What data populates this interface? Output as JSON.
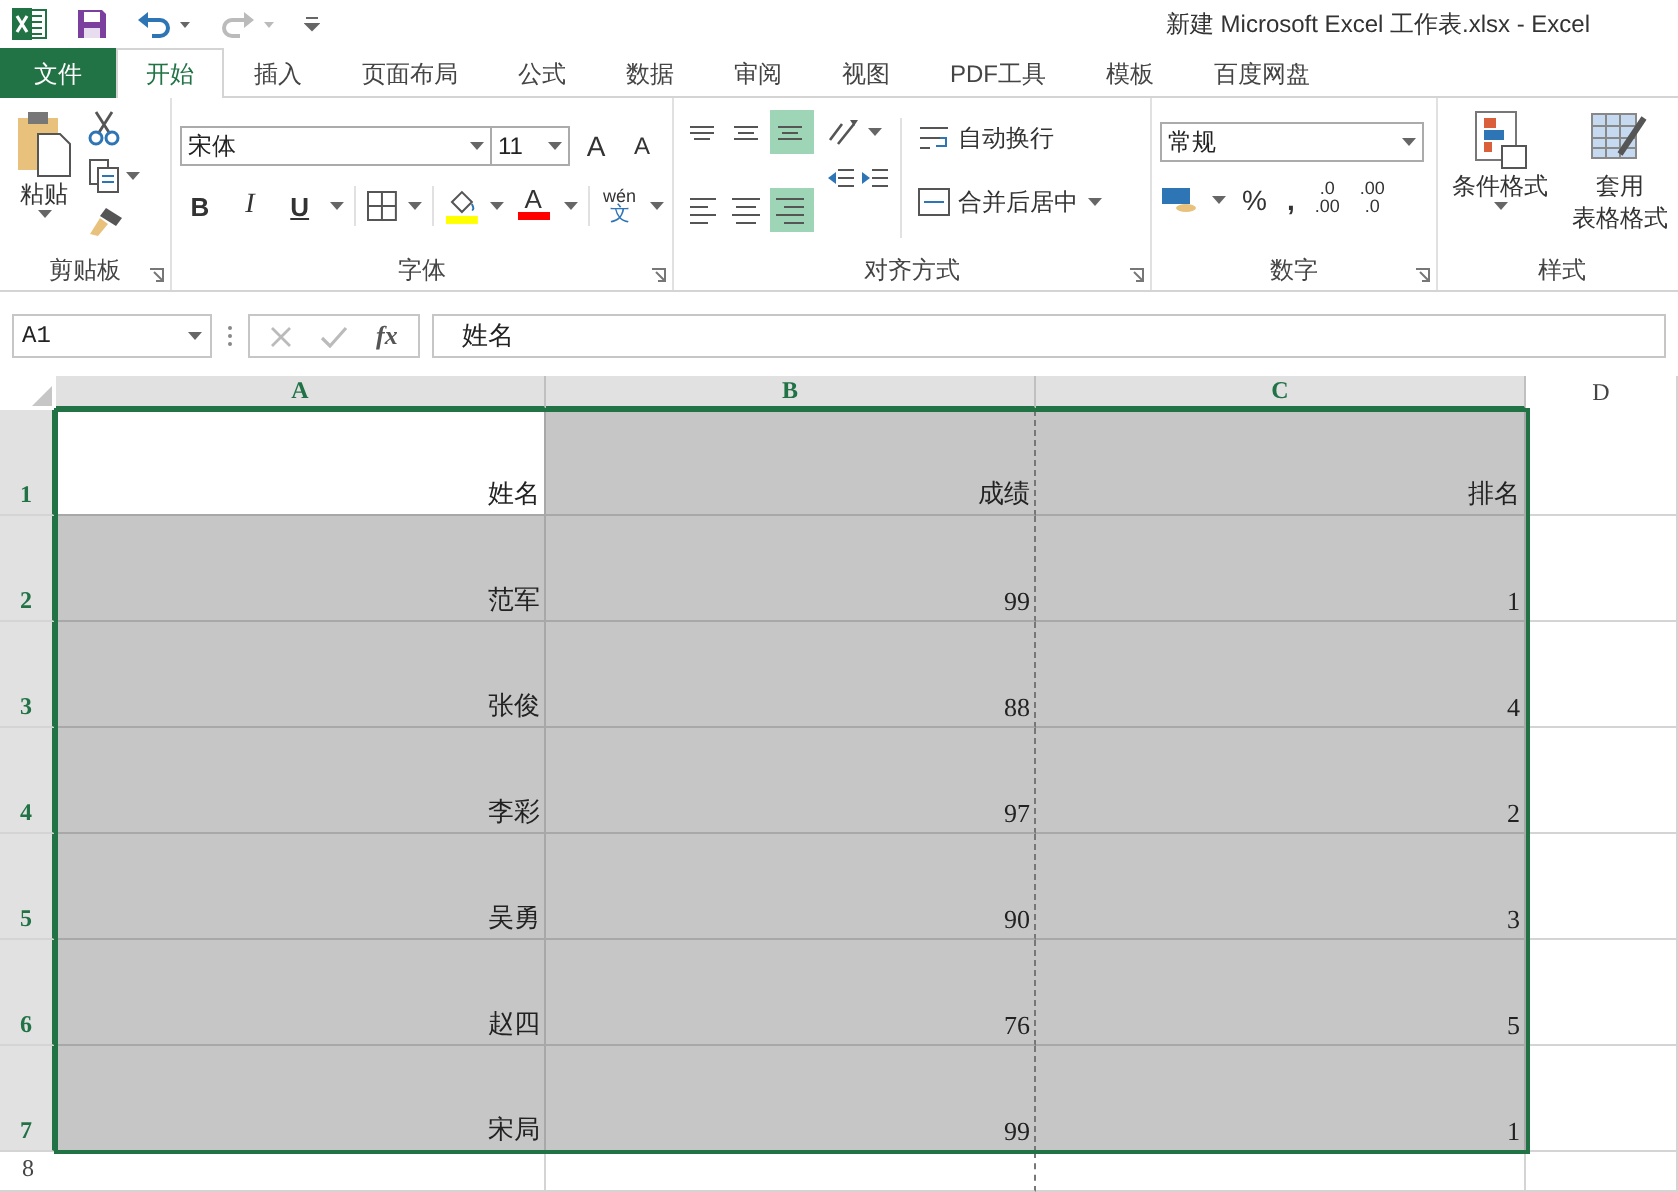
{
  "window": {
    "title": "新建 Microsoft Excel 工作表.xlsx - Excel"
  },
  "tabs": [
    {
      "label": "文件",
      "kind": "file",
      "selected": false
    },
    {
      "label": "开始",
      "kind": "tab",
      "selected": true
    },
    {
      "label": "插入",
      "kind": "tab",
      "selected": false
    },
    {
      "label": "页面布局",
      "kind": "tab",
      "selected": false
    },
    {
      "label": "公式",
      "kind": "tab",
      "selected": false
    },
    {
      "label": "数据",
      "kind": "tab",
      "selected": false
    },
    {
      "label": "审阅",
      "kind": "tab",
      "selected": false
    },
    {
      "label": "视图",
      "kind": "tab",
      "selected": false
    },
    {
      "label": "PDF工具",
      "kind": "tab",
      "selected": false
    },
    {
      "label": "模板",
      "kind": "tab",
      "selected": false
    },
    {
      "label": "百度网盘",
      "kind": "tab",
      "selected": false
    }
  ],
  "ribbon": {
    "clipboard": {
      "paste": "粘贴",
      "label": "剪贴板"
    },
    "font": {
      "name": "宋体",
      "size": "11",
      "grow": "A",
      "shrink": "A",
      "bold": "B",
      "italic": "I",
      "underline": "U",
      "font_color": "A",
      "phonetic_top": "wén",
      "phonetic_bottom": "文",
      "label": "字体"
    },
    "alignment": {
      "buttons": [
        {
          "kind": "top",
          "selected": false
        },
        {
          "kind": "middle",
          "selected": false
        },
        {
          "kind": "bottom",
          "selected": true
        },
        {
          "kind": "left",
          "selected": false
        },
        {
          "kind": "center",
          "selected": false
        },
        {
          "kind": "right",
          "selected": true
        }
      ],
      "wrap": "自动换行",
      "merge": "合并后居中",
      "label": "对齐方式"
    },
    "number": {
      "format": "常规",
      "percent": "%",
      "comma": ",",
      "increase_decimal": [
        ".0",
        ".00"
      ],
      "decrease_decimal": [
        ".00",
        ".0"
      ],
      "label": "数字"
    },
    "styles": {
      "conditional": "条件格式",
      "table_format_top": "套用",
      "table_format_bottom": "表格格式",
      "label": "样式"
    }
  },
  "formula_bar": {
    "name_box": "A1",
    "function_label": "fx",
    "formula": "姓名"
  },
  "sheet": {
    "columns": [
      {
        "label": "A",
        "selected": true
      },
      {
        "label": "B",
        "selected": true
      },
      {
        "label": "C",
        "selected": true
      },
      {
        "label": "D",
        "selected": false
      }
    ],
    "rows": [
      {
        "number": "1",
        "selected": true,
        "cells": [
          {
            "text": "姓名",
            "selected": true,
            "active": true
          },
          {
            "text": "成绩",
            "selected": true,
            "active": false
          },
          {
            "text": "排名",
            "selected": true,
            "active": false
          }
        ]
      },
      {
        "number": "2",
        "selected": true,
        "cells": [
          {
            "text": "范军",
            "selected": true,
            "active": false
          },
          {
            "text": "99",
            "selected": true,
            "active": false
          },
          {
            "text": "1",
            "selected": true,
            "active": false
          }
        ]
      },
      {
        "number": "3",
        "selected": true,
        "cells": [
          {
            "text": "张俊",
            "selected": true,
            "active": false
          },
          {
            "text": "88",
            "selected": true,
            "active": false
          },
          {
            "text": "4",
            "selected": true,
            "active": false
          }
        ]
      },
      {
        "number": "4",
        "selected": true,
        "cells": [
          {
            "text": "李彩",
            "selected": true,
            "active": false
          },
          {
            "text": "97",
            "selected": true,
            "active": false
          },
          {
            "text": "2",
            "selected": true,
            "active": false
          }
        ]
      },
      {
        "number": "5",
        "selected": true,
        "cells": [
          {
            "text": "吴勇",
            "selected": true,
            "active": false
          },
          {
            "text": "90",
            "selected": true,
            "active": false
          },
          {
            "text": "3",
            "selected": true,
            "active": false
          }
        ]
      },
      {
        "number": "6",
        "selected": true,
        "cells": [
          {
            "text": "赵四",
            "selected": true,
            "active": false
          },
          {
            "text": "76",
            "selected": true,
            "active": false
          },
          {
            "text": "5",
            "selected": true,
            "active": false
          }
        ]
      },
      {
        "number": "7",
        "selected": true,
        "cells": [
          {
            "text": "宋局",
            "selected": true,
            "active": false
          },
          {
            "text": "99",
            "selected": true,
            "active": false
          },
          {
            "text": "1",
            "selected": true,
            "active": false
          }
        ]
      },
      {
        "number": "8",
        "selected": false
      }
    ]
  }
}
